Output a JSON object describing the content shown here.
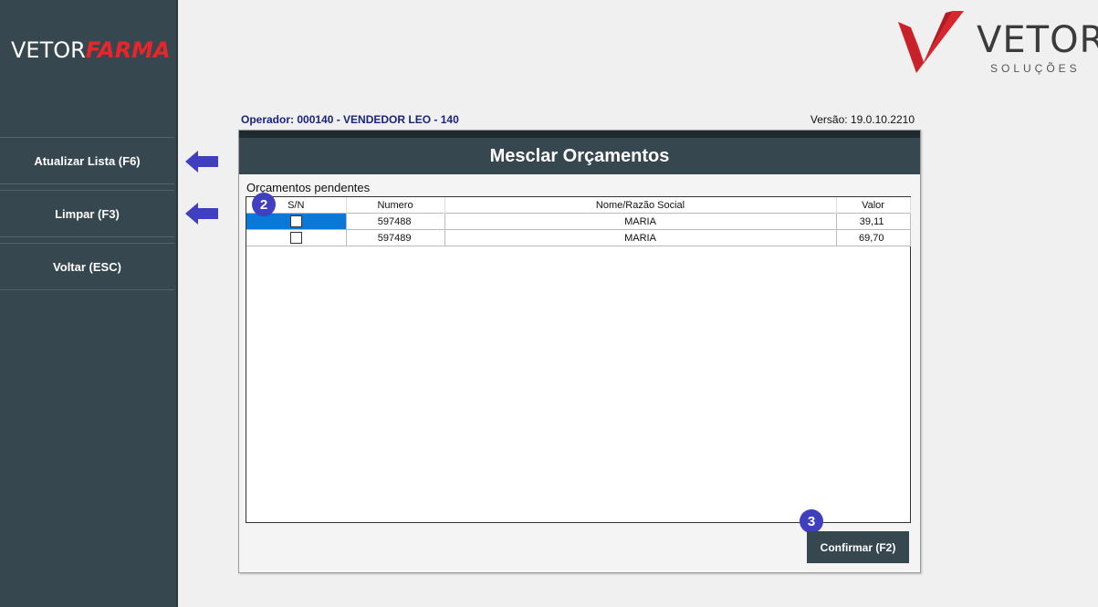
{
  "brand": {
    "part1": "VETOR",
    "part2": "FARMA"
  },
  "logo": {
    "word": "VETOR",
    "sub": "SOLUÇÕES"
  },
  "sidebar": {
    "items": [
      {
        "label": "Atualizar Lista (F6)"
      },
      {
        "label": "Limpar (F3)"
      },
      {
        "label": "Voltar (ESC)"
      }
    ]
  },
  "header": {
    "operator": "Operador: 000140 - VENDEDOR LEO - 140",
    "version": "Versão: 19.0.10.2210"
  },
  "dialog": {
    "title": "Mesclar Orçamentos",
    "section_label": "Orçamentos pendentes",
    "columns": [
      "S/N",
      "Numero",
      "Nome/Razão Social",
      "Valor"
    ],
    "rows": [
      {
        "checked": false,
        "numero": "597488",
        "nome": "MARIA",
        "valor": "39,11"
      },
      {
        "checked": false,
        "numero": "597489",
        "nome": "MARIA",
        "valor": "69,70"
      }
    ],
    "confirm_label": "Confirmar (F2)"
  },
  "badges": {
    "step2": "2",
    "step3": "3"
  },
  "colors": {
    "sidebar": "#37474f",
    "accent_red": "#e8262a",
    "selection": "#0a78d7",
    "badge": "#3f3fbf"
  }
}
